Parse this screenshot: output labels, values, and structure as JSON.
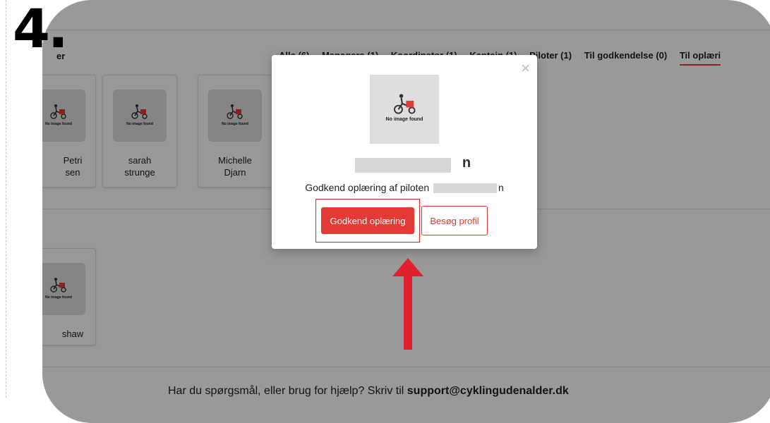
{
  "step_label": "4.",
  "page": {
    "section_title": "er",
    "tabs": [
      {
        "label": "Alle (6)",
        "active": false
      },
      {
        "label": "Managers (1)",
        "active": false
      },
      {
        "label": "Koordinator (1)",
        "active": false
      },
      {
        "label": "Kaptajn (1)",
        "active": false
      },
      {
        "label": "Piloter (1)",
        "active": false
      },
      {
        "label": "Til godkendelse (0)",
        "active": false
      },
      {
        "label": "Til oplæri",
        "active": true
      }
    ],
    "cards": [
      {
        "name_line1": "Petri",
        "name_line2": "sen"
      },
      {
        "name_line1": "sarah",
        "name_line2": "strunge"
      },
      {
        "name_line1": "Michelle",
        "name_line2": "Djarn"
      }
    ],
    "second_card": {
      "name_line1": "shaw"
    },
    "no_image_text": "No image found",
    "footer": {
      "text": "Har du spørgsmål, eller brug for hjælp? Skriv til ",
      "email": "support@cyklingudenalder.dk"
    }
  },
  "modal": {
    "close_symbol": "×",
    "image_text": "No image found",
    "name_tail": "n",
    "message": "Godkend oplæring af piloten",
    "message_tail": "n",
    "approve_label": "Godkend oplæring",
    "visit_label": "Besøg profil"
  },
  "colors": {
    "accent": "#e53935",
    "annotation_red": "#e0212b"
  }
}
